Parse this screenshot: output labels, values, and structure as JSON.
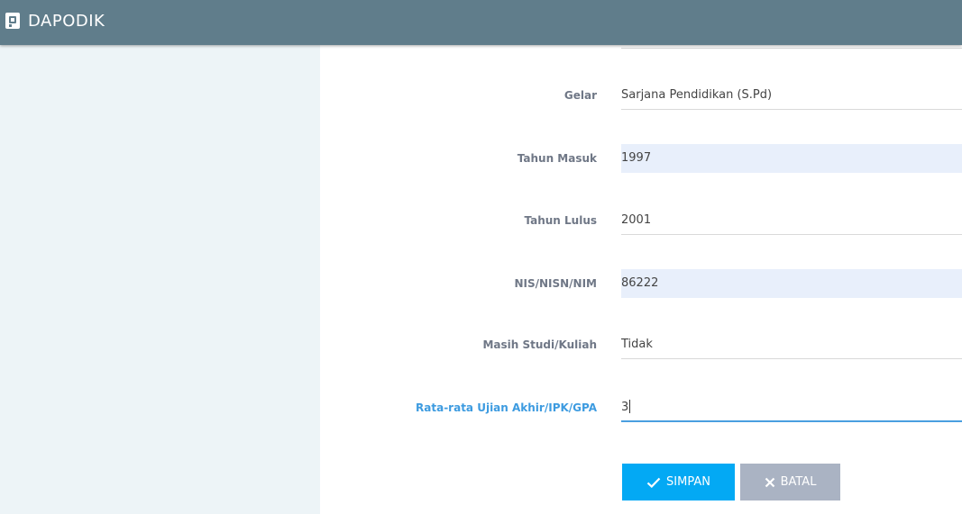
{
  "header": {
    "app_title": "DAPODIK",
    "logo_icon": "dapodik-logo-icon"
  },
  "form": {
    "fields": [
      {
        "label": "Gelar",
        "value": "Sarjana Pendidikan (S.Pd)"
      },
      {
        "label": "Tahun Masuk",
        "value": "1997"
      },
      {
        "label": "Tahun Lulus",
        "value": "2001"
      },
      {
        "label": "NIS/NISN/NIM",
        "value": "86222"
      },
      {
        "label": "Masih Studi/Kuliah",
        "value": "Tidak"
      },
      {
        "label": "Rata-rata Ujian Akhir/IPK/GPA",
        "value": "3"
      }
    ]
  },
  "actions": {
    "save_label": "SIMPAN",
    "save_icon": "check-icon",
    "cancel_label": "BATAL",
    "cancel_icon": "close-icon"
  },
  "colors": {
    "topbar": "#607d8b",
    "sidebar": "#edf4f7",
    "filled_field": "#e8effb",
    "focus_accent": "#4a9fe0",
    "save_button": "#03a9f4",
    "cancel_button": "#aab3c3"
  }
}
